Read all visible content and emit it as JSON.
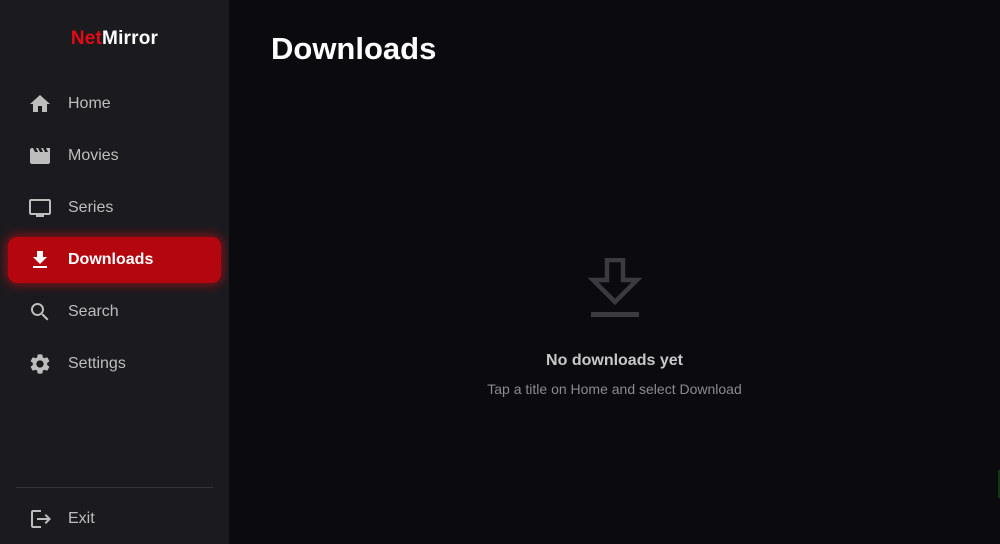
{
  "app": {
    "logo_part1": "Net",
    "logo_part2": "Mirror"
  },
  "sidebar": {
    "items": [
      {
        "label": "Home",
        "icon": "home-icon"
      },
      {
        "label": "Movies",
        "icon": "movie-icon"
      },
      {
        "label": "Series",
        "icon": "tv-icon"
      },
      {
        "label": "Downloads",
        "icon": "download-icon",
        "active": true
      },
      {
        "label": "Search",
        "icon": "search-icon"
      },
      {
        "label": "Settings",
        "icon": "gear-icon"
      }
    ],
    "exit": {
      "label": "Exit",
      "icon": "exit-icon"
    }
  },
  "main": {
    "title": "Downloads",
    "empty_icon": "download-icon",
    "empty_title": "No downloads yet",
    "empty_subtitle": "Tap a title on Home and select Download"
  },
  "colors": {
    "accent": "#e50914",
    "active_bg": "#b3060f",
    "sidebar_bg": "#1b1b1f",
    "main_bg": "#0b0a0f"
  }
}
